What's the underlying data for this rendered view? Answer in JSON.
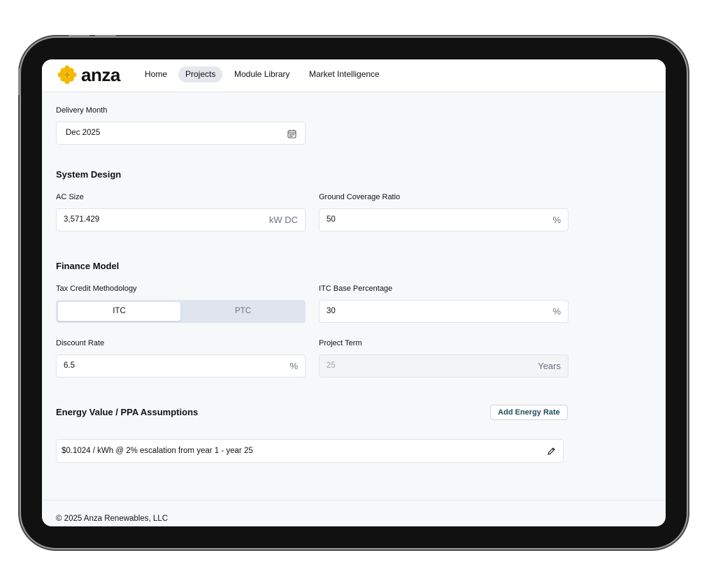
{
  "brand": {
    "name": "anza",
    "color": "#f5b800"
  },
  "nav": {
    "items": [
      {
        "label": "Home",
        "active": false
      },
      {
        "label": "Projects",
        "active": true
      },
      {
        "label": "Module Library",
        "active": false
      },
      {
        "label": "Market Intelligence",
        "active": false
      }
    ]
  },
  "delivery": {
    "label": "Delivery Month",
    "value": "Dec 2025",
    "icon": "calendar-icon"
  },
  "system_design": {
    "title": "System Design",
    "ac_size": {
      "label": "AC Size",
      "value": "3,571.429",
      "unit": "kW DC"
    },
    "gcr": {
      "label": "Ground Coverage Ratio",
      "value": "50",
      "unit": "%"
    }
  },
  "finance": {
    "title": "Finance Model",
    "tax_credit": {
      "label": "Tax Credit Methodology",
      "options": [
        "ITC",
        "PTC"
      ],
      "selected": "ITC"
    },
    "itc_base": {
      "label": "ITC Base Percentage",
      "value": "30",
      "unit": "%"
    },
    "discount": {
      "label": "Discount Rate",
      "value": "6.5",
      "unit": "%"
    },
    "term": {
      "label": "Project Term",
      "value": "25",
      "unit": "Years",
      "disabled": true
    }
  },
  "energy": {
    "title": "Energy Value / PPA Assumptions",
    "add_label": "Add Energy Rate",
    "rates": [
      "$0.1024 / kWh @ 2% escalation from year 1 - year 25"
    ],
    "edit_icon": "pencil-icon"
  },
  "footer": {
    "text": "© 2025 Anza Renewables, LLC"
  }
}
